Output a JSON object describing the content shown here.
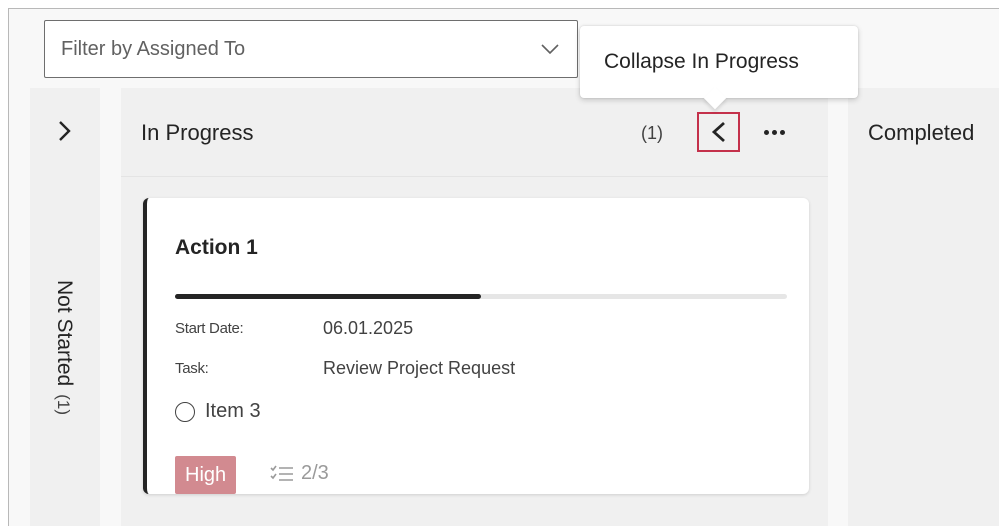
{
  "filter": {
    "placeholder": "Filter by Assigned To"
  },
  "tooltip": {
    "text": "Collapse In Progress"
  },
  "columns": {
    "not_started": {
      "title": "Not Started",
      "count": "(1)"
    },
    "in_progress": {
      "title": "In Progress",
      "count": "(1)"
    },
    "completed": {
      "title": "Completed"
    }
  },
  "card": {
    "title": "Action 1",
    "progress_fraction": 0.5,
    "start_date_label": "Start Date:",
    "start_date_value": "06.01.2025",
    "task_label": "Task:",
    "task_value": "Review Project Request",
    "item_label": "Item 3",
    "priority": "High",
    "checklist": "2/3"
  },
  "colors": {
    "highlight_border": "#c4314b",
    "priority_badge": "#d28a90",
    "column_bg": "#f0f0f0"
  },
  "icons": {
    "filter": "chevron-down-icon",
    "expand": "chevron-right-icon",
    "collapse": "chevron-left-icon",
    "more": "more-horizontal-icon",
    "item": "radio-circle-icon",
    "checklist": "checklist-icon"
  }
}
